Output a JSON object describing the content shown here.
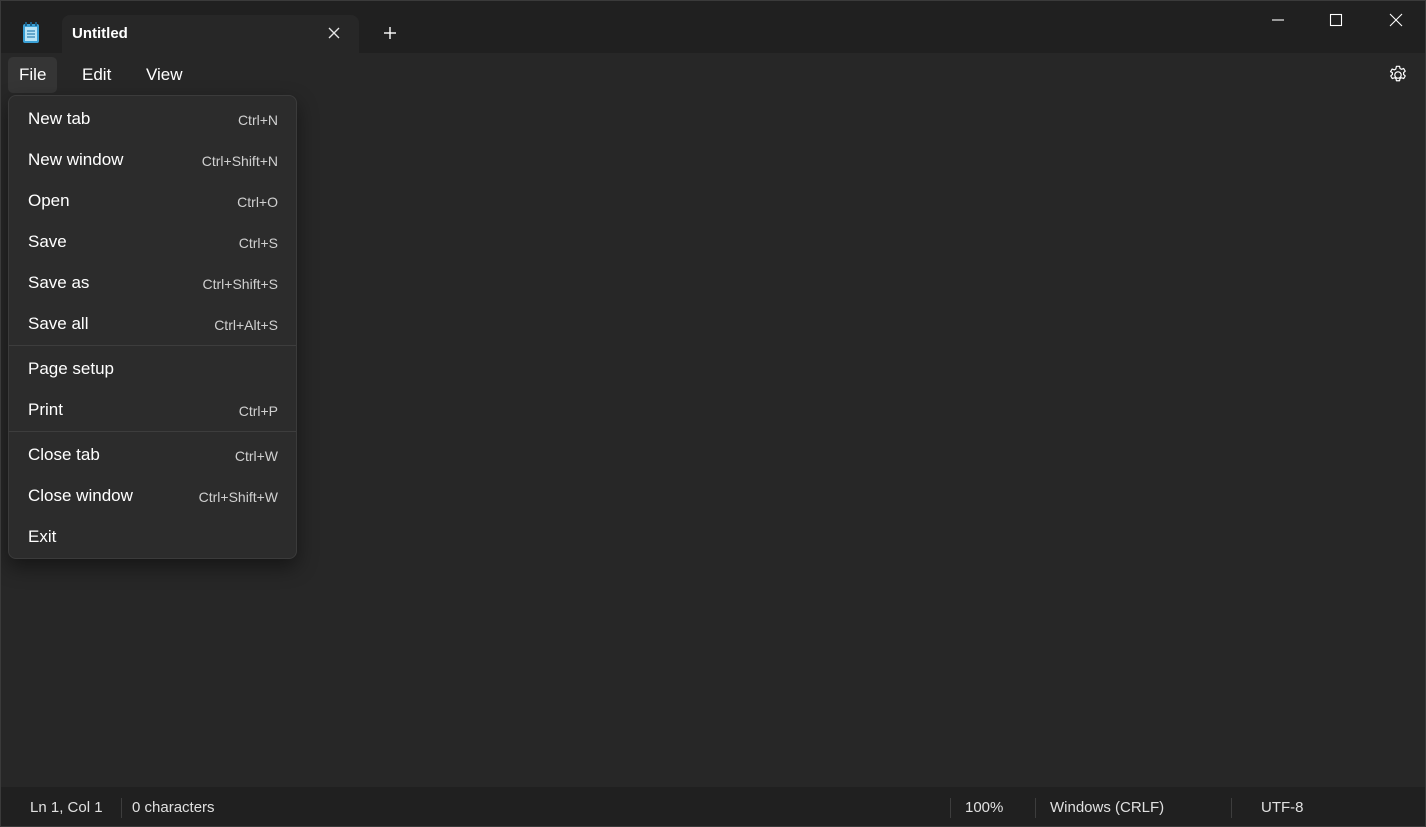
{
  "tab": {
    "title": "Untitled"
  },
  "menubar": {
    "file": "File",
    "edit": "Edit",
    "view": "View"
  },
  "file_menu": {
    "new_tab": {
      "label": "New tab",
      "shortcut": "Ctrl+N"
    },
    "new_window": {
      "label": "New window",
      "shortcut": "Ctrl+Shift+N"
    },
    "open": {
      "label": "Open",
      "shortcut": "Ctrl+O"
    },
    "save": {
      "label": "Save",
      "shortcut": "Ctrl+S"
    },
    "save_as": {
      "label": "Save as",
      "shortcut": "Ctrl+Shift+S"
    },
    "save_all": {
      "label": "Save all",
      "shortcut": "Ctrl+Alt+S"
    },
    "page_setup": {
      "label": "Page setup"
    },
    "print": {
      "label": "Print",
      "shortcut": "Ctrl+P"
    },
    "close_tab": {
      "label": "Close tab",
      "shortcut": "Ctrl+W"
    },
    "close_window": {
      "label": "Close window",
      "shortcut": "Ctrl+Shift+W"
    },
    "exit": {
      "label": "Exit"
    }
  },
  "status": {
    "position": "Ln 1, Col 1",
    "characters": "0 characters",
    "zoom": "100%",
    "line_ending": "Windows (CRLF)",
    "encoding": "UTF-8"
  },
  "colors": {
    "background": "#272727",
    "titlebar": "#202020",
    "menu": "#2c2c2c",
    "app_icon": "#4fc3f7"
  },
  "icons": {
    "app": "notepad-icon",
    "close_tab": "close-icon",
    "new_tab": "plus-icon",
    "minimize": "minimize-icon",
    "maximize": "maximize-icon",
    "close": "close-icon",
    "settings": "gear-icon"
  }
}
